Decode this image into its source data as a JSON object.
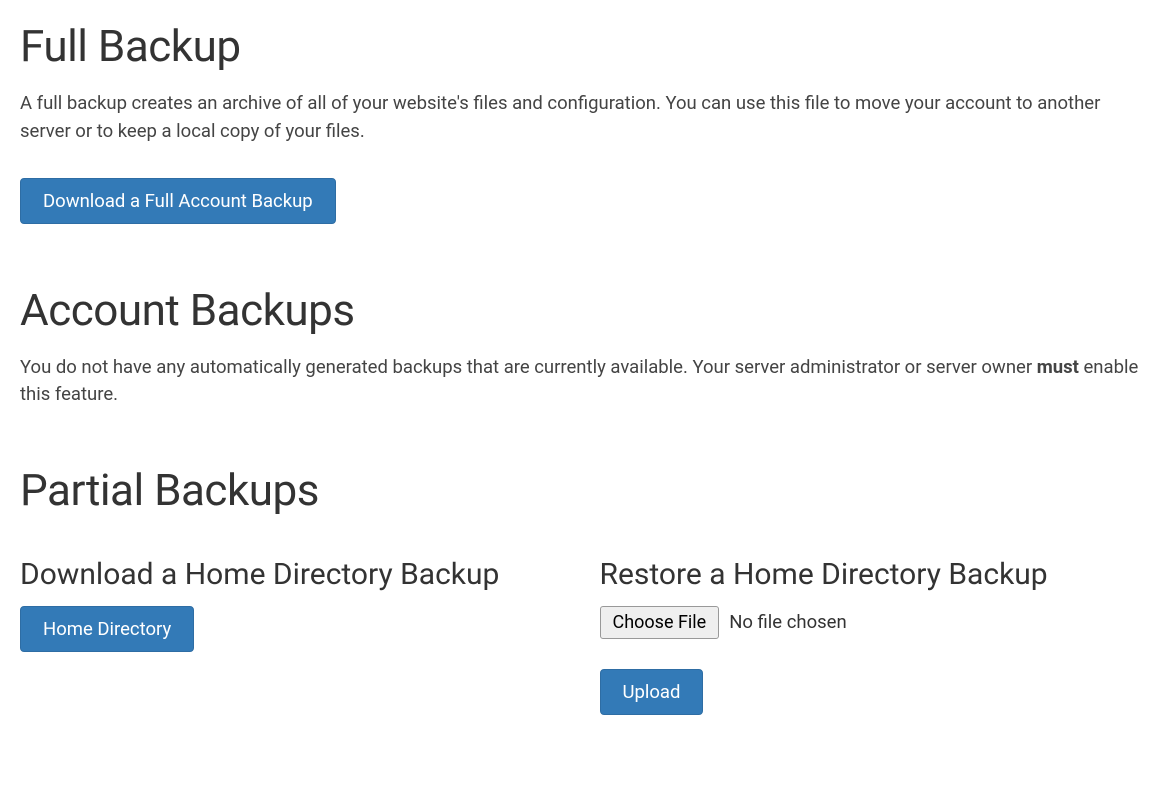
{
  "full_backup": {
    "title": "Full Backup",
    "description": "A full backup creates an archive of all of your website's files and configuration. You can use this file to move your account to another server or to keep a local copy of your files.",
    "button_label": "Download a Full Account Backup"
  },
  "account_backups": {
    "title": "Account Backups",
    "description_pre": "You do not have any automatically generated backups that are currently available. Your server administrator or server owner ",
    "description_strong": "must",
    "description_post": " enable this feature."
  },
  "partial_backups": {
    "title": "Partial Backups",
    "download": {
      "title": "Download a Home Directory Backup",
      "button_label": "Home Directory"
    },
    "restore": {
      "title": "Restore a Home Directory Backup",
      "choose_file_label": "Choose File",
      "no_file_text": "No file chosen",
      "upload_label": "Upload"
    }
  }
}
